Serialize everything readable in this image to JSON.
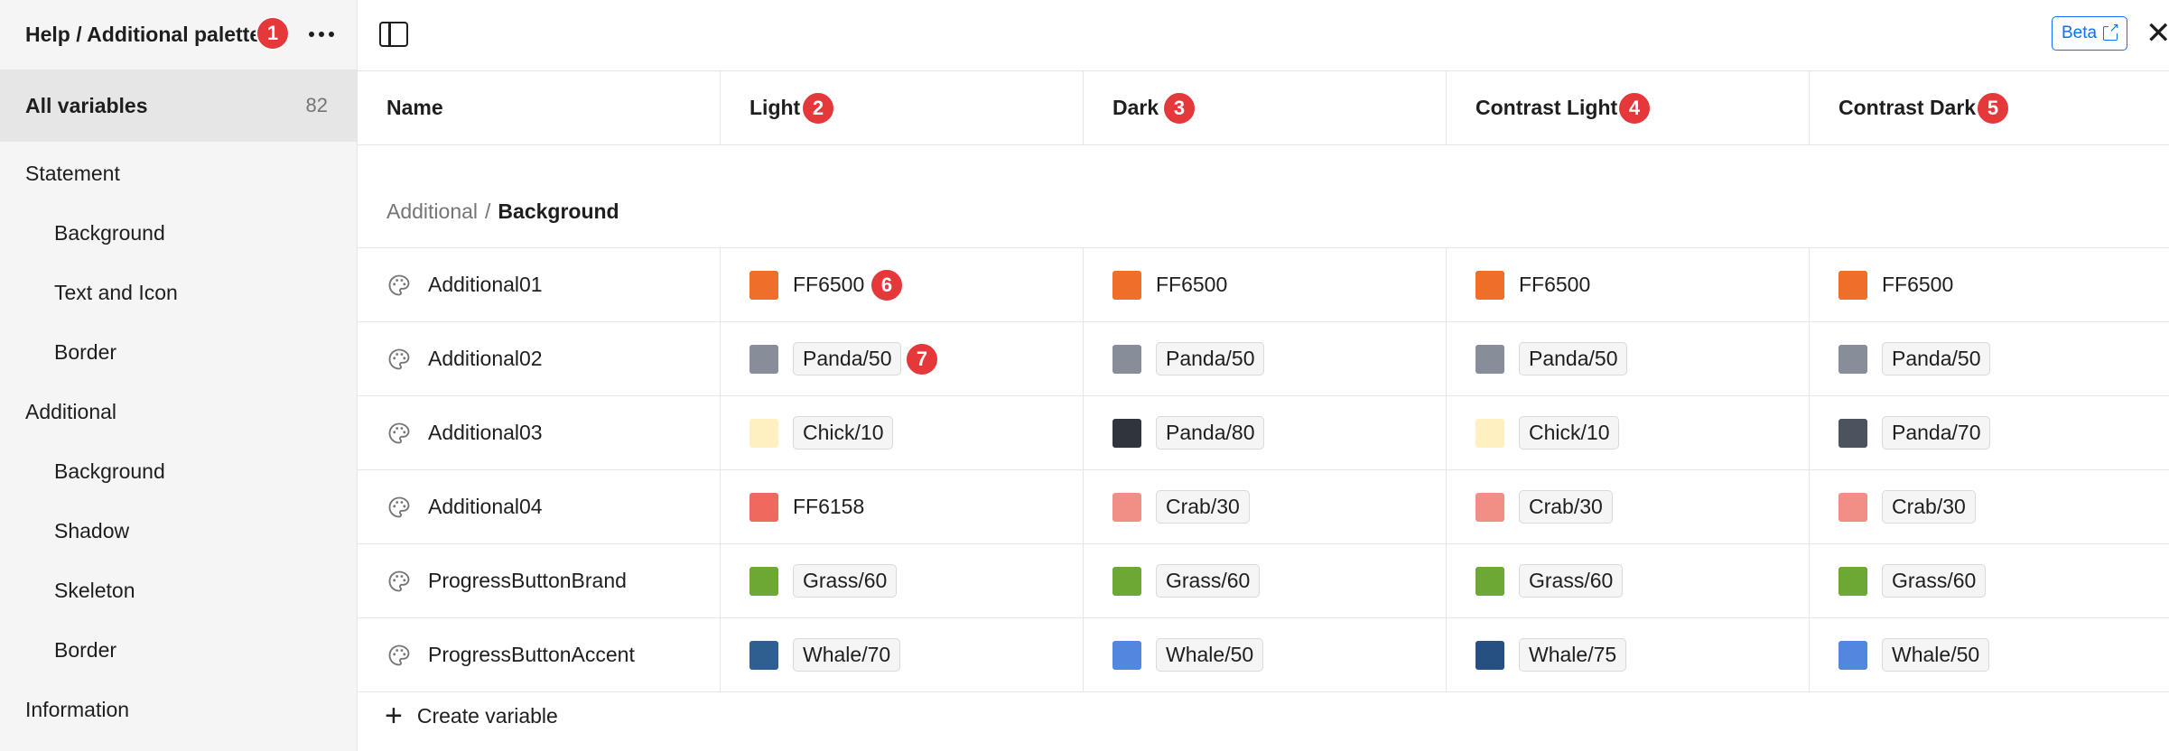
{
  "sidebar": {
    "title": "Help / Additional palette",
    "all_variables": {
      "label": "All variables",
      "count": "82"
    },
    "items": [
      {
        "label": "Statement",
        "level": "group"
      },
      {
        "label": "Background",
        "level": "child"
      },
      {
        "label": "Text and Icon",
        "level": "child"
      },
      {
        "label": "Border",
        "level": "child"
      },
      {
        "label": "Additional",
        "level": "group"
      },
      {
        "label": "Background",
        "level": "child"
      },
      {
        "label": "Shadow",
        "level": "child"
      },
      {
        "label": "Skeleton",
        "level": "child"
      },
      {
        "label": "Border",
        "level": "child"
      },
      {
        "label": "Information",
        "level": "group"
      }
    ]
  },
  "topbar": {
    "beta_label": "Beta",
    "close_icon": "close-icon",
    "panel_icon": "sidebar-toggle-icon"
  },
  "columns": {
    "name": "Name",
    "modes": [
      "Light",
      "Dark",
      "Contrast Light",
      "Contrast Dark"
    ]
  },
  "section": {
    "parent": "Additional",
    "separator": "/",
    "current": "Background"
  },
  "rows": [
    {
      "name": "Additional01",
      "values": [
        {
          "color": "#EE6E2A",
          "text": "FF6500",
          "kind": "hex"
        },
        {
          "color": "#EE6E2A",
          "text": "FF6500",
          "kind": "hex"
        },
        {
          "color": "#EE6E2A",
          "text": "FF6500",
          "kind": "hex"
        },
        {
          "color": "#EE6E2A",
          "text": "FF6500",
          "kind": "hex"
        }
      ]
    },
    {
      "name": "Additional02",
      "values": [
        {
          "color": "#878E99",
          "text": "Panda/50",
          "kind": "alias"
        },
        {
          "color": "#878E99",
          "text": "Panda/50",
          "kind": "alias"
        },
        {
          "color": "#878E99",
          "text": "Panda/50",
          "kind": "alias"
        },
        {
          "color": "#878E99",
          "text": "Panda/50",
          "kind": "alias"
        }
      ]
    },
    {
      "name": "Additional03",
      "values": [
        {
          "color": "#FFF0C2",
          "text": "Chick/10",
          "kind": "alias"
        },
        {
          "color": "#2E353D",
          "text": "Panda/80",
          "kind": "alias"
        },
        {
          "color": "#FFF0C2",
          "text": "Chick/10",
          "kind": "alias"
        },
        {
          "color": "#4A535E",
          "text": "Panda/70",
          "kind": "alias"
        }
      ]
    },
    {
      "name": "Additional04",
      "values": [
        {
          "color": "#EE6A5F",
          "text": "FF6158",
          "kind": "hex"
        },
        {
          "color": "#F08F85",
          "text": "Crab/30",
          "kind": "alias"
        },
        {
          "color": "#F08F85",
          "text": "Crab/30",
          "kind": "alias"
        },
        {
          "color": "#F08F85",
          "text": "Crab/30",
          "kind": "alias"
        }
      ]
    },
    {
      "name": "ProgressButtonBrand",
      "values": [
        {
          "color": "#6DA834",
          "text": "Grass/60",
          "kind": "alias"
        },
        {
          "color": "#6DA834",
          "text": "Grass/60",
          "kind": "alias"
        },
        {
          "color": "#6DA834",
          "text": "Grass/60",
          "kind": "alias"
        },
        {
          "color": "#6DA834",
          "text": "Grass/60",
          "kind": "alias"
        }
      ]
    },
    {
      "name": "ProgressButtonAccent",
      "values": [
        {
          "color": "#2F5E91",
          "text": "Whale/70",
          "kind": "alias"
        },
        {
          "color": "#5386DE",
          "text": "Whale/50",
          "kind": "alias"
        },
        {
          "color": "#25507F",
          "text": "Whale/75",
          "kind": "alias"
        },
        {
          "color": "#5386DE",
          "text": "Whale/50",
          "kind": "alias"
        }
      ]
    }
  ],
  "create_label": "Create variable",
  "badges": [
    "1",
    "2",
    "3",
    "4",
    "5",
    "6",
    "7"
  ],
  "colors": {
    "accent": "#0D6EFD",
    "badge": "#E5383B",
    "sidebar_bg": "#F5F5F5",
    "selected_bg": "#E6E6E6"
  }
}
